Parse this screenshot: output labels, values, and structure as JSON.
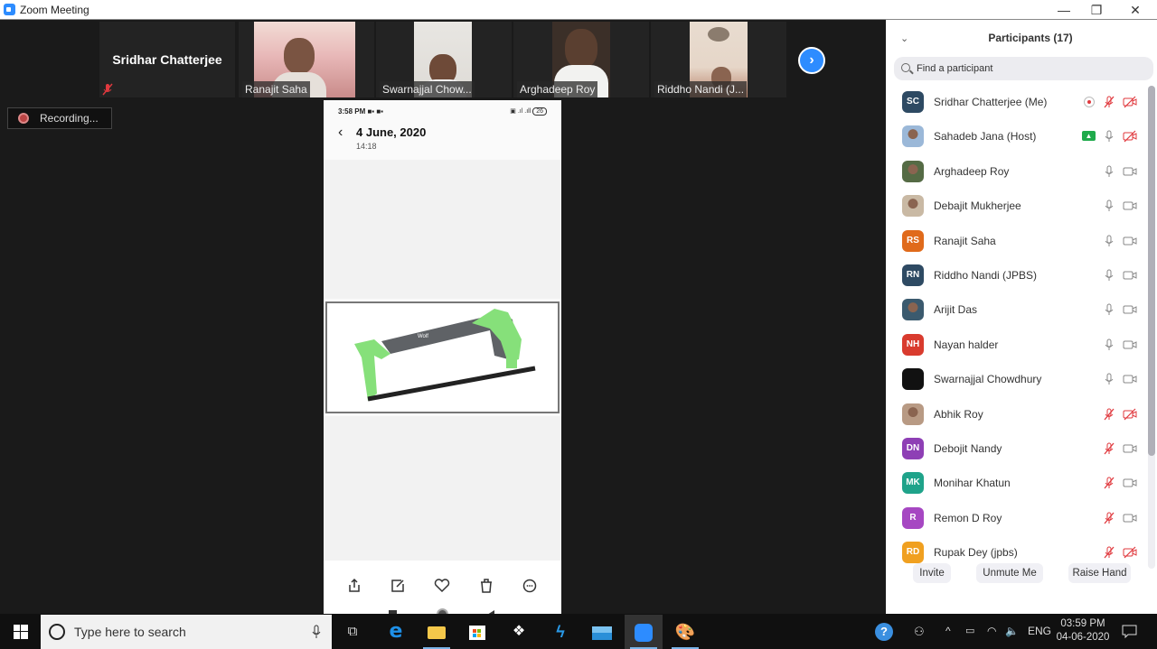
{
  "window": {
    "title": "Zoom Meeting",
    "controls": [
      "minimize",
      "restore",
      "close"
    ]
  },
  "gallery": {
    "tiles": [
      {
        "name": "Sridhar Chatterjee",
        "video": false,
        "muted": true
      },
      {
        "name": "Ranajit  Saha",
        "video": true
      },
      {
        "name": "Swarnajjal Chow...",
        "video": true
      },
      {
        "name": "Arghadeep Roy",
        "video": true
      },
      {
        "name": "Riddho Nandi (J...",
        "video": true
      }
    ],
    "next_label": "›"
  },
  "recording": {
    "label": "Recording..."
  },
  "shared_screen": {
    "status_time": "3:58 PM",
    "battery": "26",
    "back_label": "‹",
    "date": "4 June, 2020",
    "time": "14:18",
    "tools": [
      "share",
      "edit",
      "favorite",
      "delete",
      "more"
    ],
    "nav": [
      "recents",
      "home",
      "back"
    ]
  },
  "participants": {
    "title": "Participants (17)",
    "search_placeholder": "Find a participant",
    "list": [
      {
        "initials": "SC",
        "name": "Sridhar Chatterjee (Me)",
        "avatar_color": "#2e4a63",
        "photo": false,
        "recording": true,
        "mic": "muted",
        "video": "off"
      },
      {
        "initials": "",
        "name": "Sahadeb Jana (Host)",
        "avatar_color": "#9bb8d8",
        "photo": true,
        "share": true,
        "mic": "on",
        "video": "off"
      },
      {
        "initials": "",
        "name": "Arghadeep Roy",
        "avatar_color": "#556b45",
        "photo": true,
        "mic": "on",
        "video": "on"
      },
      {
        "initials": "",
        "name": "Debajit Mukherjee",
        "avatar_color": "#c9b9a4",
        "photo": true,
        "mic": "on",
        "video": "on"
      },
      {
        "initials": "RS",
        "name": "Ranajit  Saha",
        "avatar_color": "#e06a1b",
        "photo": false,
        "mic": "on",
        "video": "on"
      },
      {
        "initials": "RN",
        "name": "Riddho Nandi (JPBS)",
        "avatar_color": "#2e4a63",
        "photo": false,
        "mic": "on",
        "video": "on"
      },
      {
        "initials": "",
        "name": "Arijit Das",
        "avatar_color": "#3b5a6e",
        "photo": true,
        "mic": "on",
        "video": "on"
      },
      {
        "initials": "NH",
        "name": "Nayan halder",
        "avatar_color": "#d93b2e",
        "photo": false,
        "mic": "on",
        "video": "on"
      },
      {
        "initials": "",
        "name": "Swarnajjal Chowdhury",
        "avatar_color": "#111111",
        "photo": false,
        "mic": "on",
        "video": "on"
      },
      {
        "initials": "",
        "name": "Abhik Roy",
        "avatar_color": "#b89a84",
        "photo": true,
        "mic": "muted",
        "video": "off"
      },
      {
        "initials": "DN",
        "name": "Debojit Nandy",
        "avatar_color": "#8e3fb5",
        "photo": false,
        "mic": "muted",
        "video": "on"
      },
      {
        "initials": "MK",
        "name": "Monihar Khatun",
        "avatar_color": "#1fa38a",
        "photo": false,
        "mic": "muted",
        "video": "on"
      },
      {
        "initials": "R",
        "name": "Remon D Roy",
        "avatar_color": "#a647c2",
        "photo": false,
        "mic": "muted",
        "video": "on"
      },
      {
        "initials": "RD",
        "name": "Rupak Dey (jpbs)",
        "avatar_color": "#f0a020",
        "photo": false,
        "mic": "muted",
        "video": "off"
      }
    ],
    "buttons": {
      "invite": "Invite",
      "unmute": "Unmute Me",
      "raise_hand": "Raise Hand"
    }
  },
  "taskbar": {
    "search_placeholder": "Type here to search",
    "language": "ENG",
    "time": "03:59 PM",
    "date": "04-06-2020"
  },
  "colors": {
    "zoom_blue": "#2d8cff",
    "muted_red": "#e0393e",
    "share_green": "#1faa4b"
  }
}
